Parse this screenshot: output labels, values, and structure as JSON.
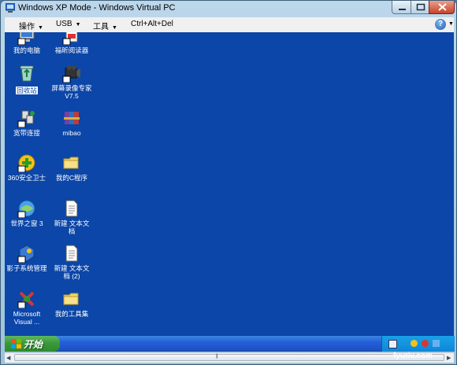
{
  "window": {
    "title": "Windows XP Mode - Windows Virtual PC"
  },
  "menubar": {
    "items": [
      {
        "label": "操作"
      },
      {
        "label": "USB"
      },
      {
        "label": "工具"
      },
      {
        "label": "Ctrl+Alt+Del"
      }
    ],
    "help_label": "?"
  },
  "desktop": {
    "background_color": "#0b46a8",
    "icons": [
      {
        "label": "我的电脑",
        "icon": "computer-icon"
      },
      {
        "label": "福昕阅读器",
        "icon": "pdf-reader-icon"
      },
      {
        "label": "回收站",
        "icon": "recycle-bin-icon",
        "selected": true
      },
      {
        "label": "屏幕录像专家",
        "label2": "V7.5",
        "icon": "screen-recorder-icon"
      },
      {
        "label": "宽带连接",
        "icon": "broadband-icon"
      },
      {
        "label": "mibao",
        "icon": "winrar-icon"
      },
      {
        "label": "360安全卫士",
        "icon": "360-security-icon"
      },
      {
        "label": "我的C程序",
        "icon": "folder-icon"
      },
      {
        "label": "世界之窗 3",
        "icon": "browser-icon"
      },
      {
        "label": "新建 文本文",
        "label2": "档",
        "icon": "text-document-icon"
      },
      {
        "label": "影子系统管理",
        "icon": "shadow-system-icon"
      },
      {
        "label": "新建 文本文",
        "label2": "档 (2)",
        "icon": "text-document-icon"
      },
      {
        "label": "Microsoft",
        "label2": "Visual ...",
        "icon": "visual-studio-icon"
      },
      {
        "label": "我的工具集",
        "icon": "folder-icon"
      }
    ]
  },
  "taskbar": {
    "start_label": "开始"
  },
  "watermark": "fyuriv.com"
}
